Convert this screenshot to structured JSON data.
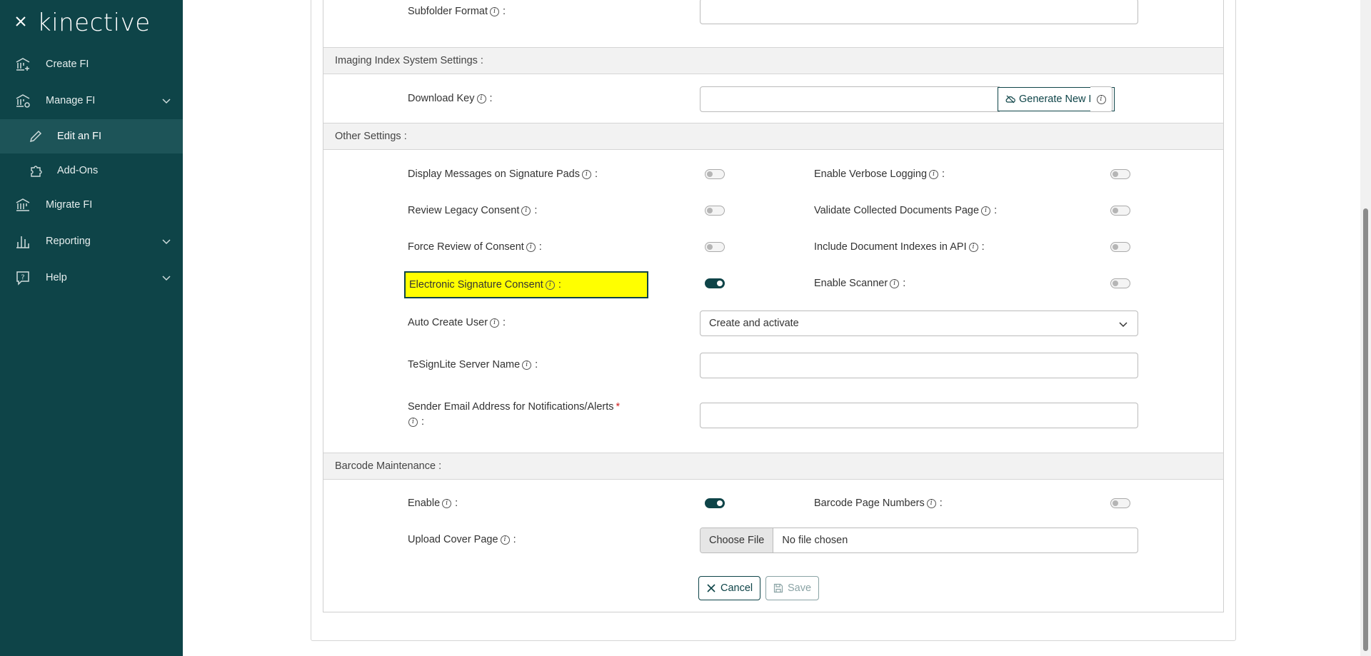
{
  "sidebar": {
    "logo": "kinective",
    "items": [
      {
        "label": "Create FI"
      },
      {
        "label": "Manage FI"
      },
      {
        "label": "Edit an FI"
      },
      {
        "label": "Add-Ons"
      },
      {
        "label": "Migrate FI"
      },
      {
        "label": "Reporting"
      },
      {
        "label": "Help"
      }
    ]
  },
  "form": {
    "subfolder_format": {
      "label": "Subfolder Format",
      "value": ""
    },
    "imaging_section": "Imaging Index System Settings :",
    "download_key": {
      "label": "Download Key",
      "value": "",
      "generate_label": "Generate New Key"
    },
    "other_section": "Other Settings :",
    "toggles_left": [
      {
        "label": "Display Messages on Signature Pads",
        "on": false
      },
      {
        "label": "Review Legacy Consent",
        "on": false
      },
      {
        "label": "Force Review of Consent",
        "on": false
      },
      {
        "label": "Electronic Signature Consent",
        "on": true
      }
    ],
    "toggles_right": [
      {
        "label": "Enable Verbose Logging",
        "on": false
      },
      {
        "label": "Validate Collected Documents Page",
        "on": false
      },
      {
        "label": "Include Document Indexes in API",
        "on": false
      },
      {
        "label": "Enable Scanner",
        "on": false
      }
    ],
    "auto_create_user": {
      "label": "Auto Create User",
      "value": "Create and activate"
    },
    "tesignlite_server": {
      "label": "TeSignLite Server Name",
      "value": ""
    },
    "sender_email": {
      "label": "Sender Email Address for Notifications/Alerts",
      "required_mark": "*",
      "value": ""
    },
    "barcode_section": "Barcode Maintenance :",
    "barcode_enable": {
      "label": "Enable",
      "on": true
    },
    "barcode_page_numbers": {
      "label": "Barcode Page Numbers",
      "on": false
    },
    "upload_cover": {
      "label": "Upload Cover Page",
      "button": "Choose File",
      "status": "No file chosen"
    },
    "cancel_label": "Cancel",
    "save_label": "Save"
  },
  "colors": {
    "sidebar_bg": "#0e4448",
    "accent": "#0e4448",
    "highlight": "#ffff00"
  }
}
